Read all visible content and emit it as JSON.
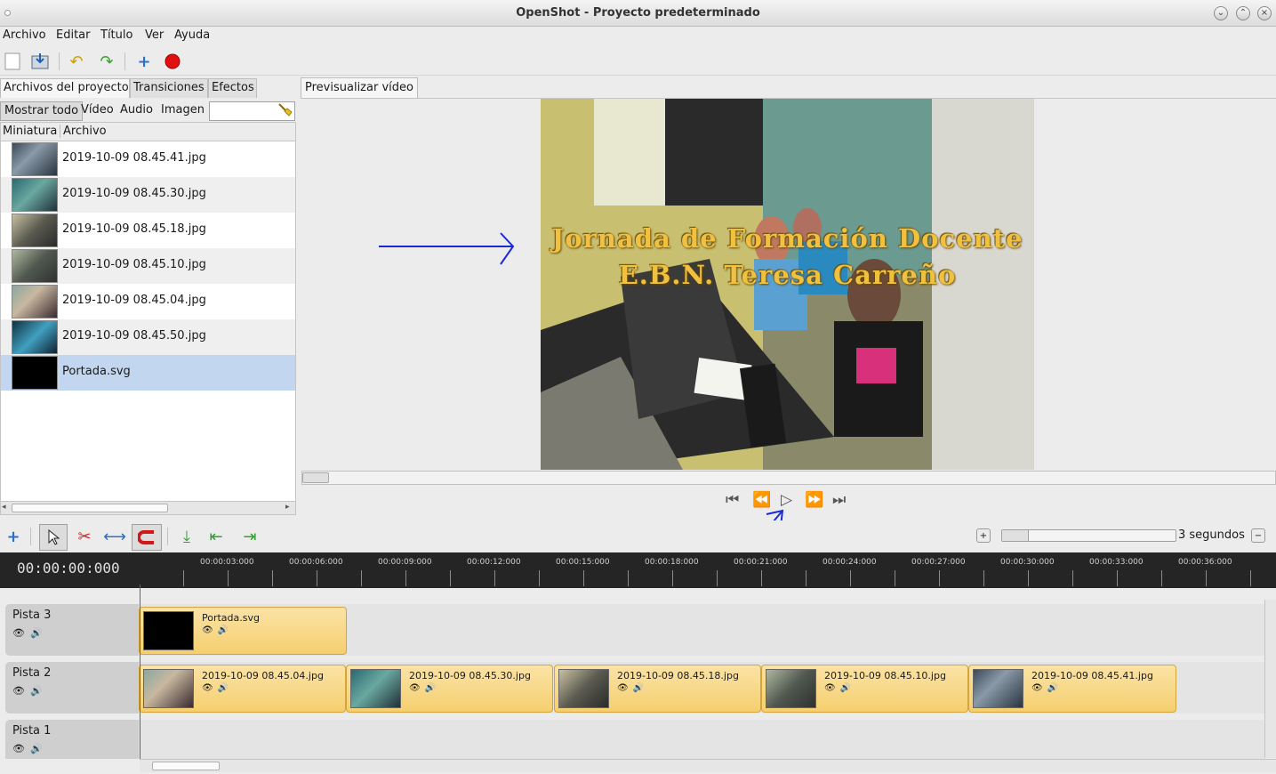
{
  "window": {
    "title": "OpenShot - Proyecto predeterminado"
  },
  "menu": [
    "Archivo",
    "Editar",
    "Título",
    "Ver",
    "Ayuda"
  ],
  "left_tabs": [
    "Archivos del proyecto",
    "Transiciones",
    "Efectos"
  ],
  "filters": [
    "Mostrar todo",
    "Vídeo",
    "Audio",
    "Imagen"
  ],
  "filter_search": {
    "value": "",
    "placeholder": ""
  },
  "columns": [
    "Miniatura",
    "Archivo"
  ],
  "files": [
    "2019-10-09 08.45.41.jpg",
    "2019-10-09 08.45.30.jpg",
    "2019-10-09 08.45.18.jpg",
    "2019-10-09 08.45.10.jpg",
    "2019-10-09 08.45.04.jpg",
    "2019-10-09 08.45.50.jpg",
    "Portada.svg"
  ],
  "preview": {
    "tab": "Previsualizar vídeo",
    "title_line1": "Jornada de Formación Docente",
    "title_line2": "E.B.N. Teresa Carreño"
  },
  "zoom_label": "3 segundos",
  "timeline": {
    "timecode": "00:00:00:000",
    "ruler": [
      "00:00:03:000",
      "00:00:06:000",
      "00:00:09:000",
      "00:00:12:000",
      "00:00:15:000",
      "00:00:18:000",
      "00:00:21:000",
      "00:00:24:000",
      "00:00:27:000",
      "00:00:30:000",
      "00:00:33:000",
      "00:00:36:000"
    ],
    "tracks": [
      {
        "name": "Pista 3",
        "clips": [
          "Portada.svg"
        ]
      },
      {
        "name": "Pista 2",
        "clips": [
          "2019-10-09 08.45.04.jpg",
          "2019-10-09 08.45.30.jpg",
          "2019-10-09 08.45.18.jpg",
          "2019-10-09 08.45.10.jpg",
          "2019-10-09 08.45.41.jpg"
        ]
      },
      {
        "name": "Pista 1",
        "clips": []
      }
    ]
  },
  "colors": {
    "selected_row": "#c2d6f0",
    "clip": "#f5cf6f",
    "ruler_bg": "#252525",
    "playhead": "#e03030",
    "title_text": "#f0c040"
  }
}
